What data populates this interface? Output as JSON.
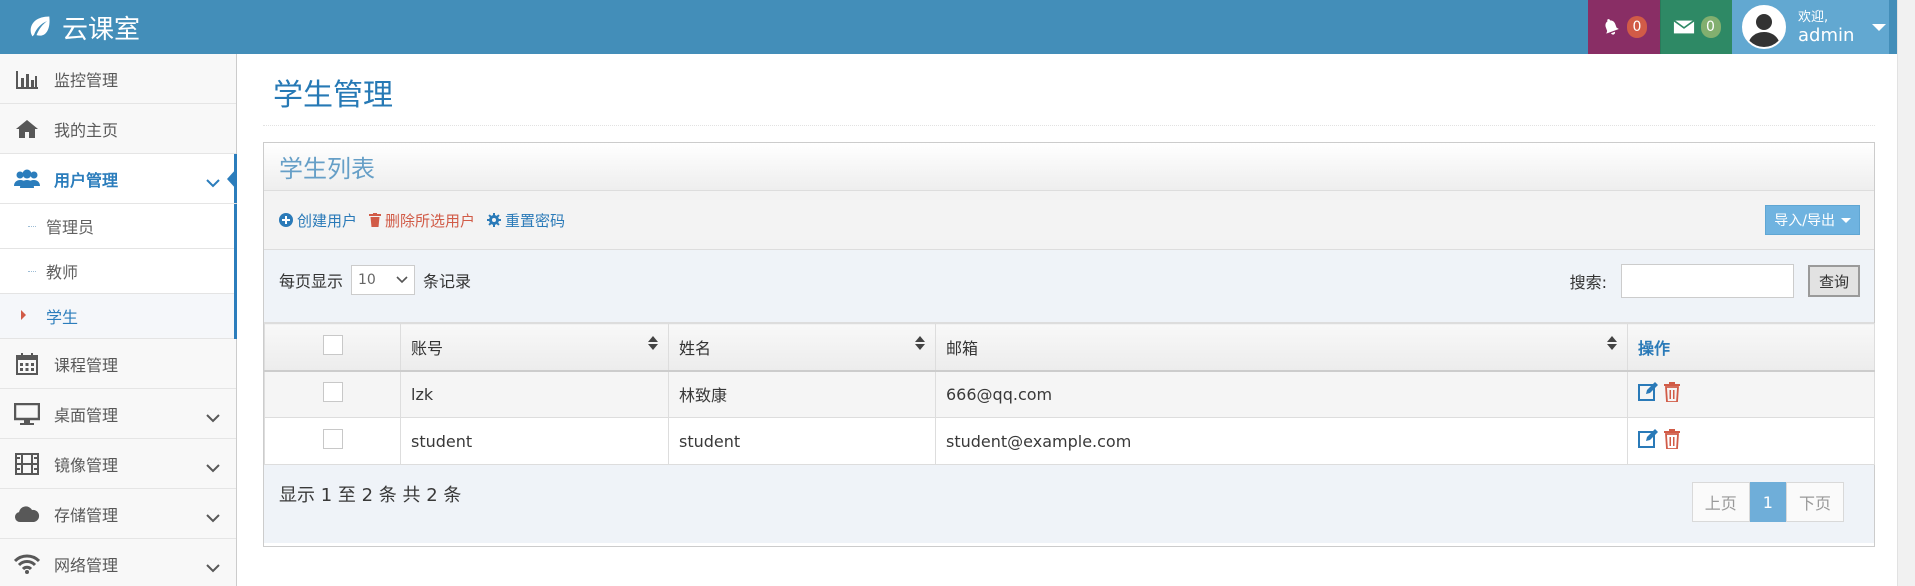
{
  "brand": {
    "name": "云课室",
    "icon": "leaf-icon"
  },
  "header": {
    "notifications": {
      "icon": "bell-icon",
      "count": "0"
    },
    "messages": {
      "icon": "envelope-icon",
      "count": "0"
    },
    "user": {
      "welcome": "欢迎,",
      "name": "admin"
    }
  },
  "sidebar": {
    "items": [
      {
        "label": "监控管理",
        "icon": "bar-chart-icon"
      },
      {
        "label": "我的主页",
        "icon": "home-icon"
      },
      {
        "label": "用户管理",
        "icon": "users-icon"
      },
      {
        "label": "课程管理",
        "icon": "calendar-icon"
      },
      {
        "label": "桌面管理",
        "icon": "desktop-icon"
      },
      {
        "label": "镜像管理",
        "icon": "film-icon"
      },
      {
        "label": "存储管理",
        "icon": "cloud-icon"
      },
      {
        "label": "网络管理",
        "icon": "wifi-icon"
      }
    ],
    "sub_items": [
      "管理员",
      "教师",
      "学生"
    ]
  },
  "page": {
    "title": "学生管理"
  },
  "widget": {
    "title": "学生列表"
  },
  "toolbar": {
    "create": "创建用户",
    "delete": "删除所选用户",
    "reset": "重置密码",
    "import_export": "导入/导出"
  },
  "controls": {
    "show_prefix": "每页显示",
    "page_size": "10",
    "show_suffix": "条记录",
    "search_label": "搜索:",
    "search_value": "",
    "query": "查询"
  },
  "table": {
    "headers": [
      "账号",
      "姓名",
      "邮箱",
      "操作"
    ],
    "rows": [
      {
        "account": "lzk",
        "name": "林致康",
        "email": "666@qq.com"
      },
      {
        "account": "student",
        "name": "student",
        "email": "student@example.com"
      }
    ]
  },
  "footer": {
    "info": "显示 1 至 2 条  共 2 条",
    "prev": "上页",
    "current": "1",
    "next": "下页"
  },
  "colors": {
    "navbar": "#438eb9",
    "notif": "#892e65",
    "mail": "#2e8965",
    "user": "#62a8d1",
    "accent": "#2b7dbc",
    "danger": "#d15b47"
  }
}
